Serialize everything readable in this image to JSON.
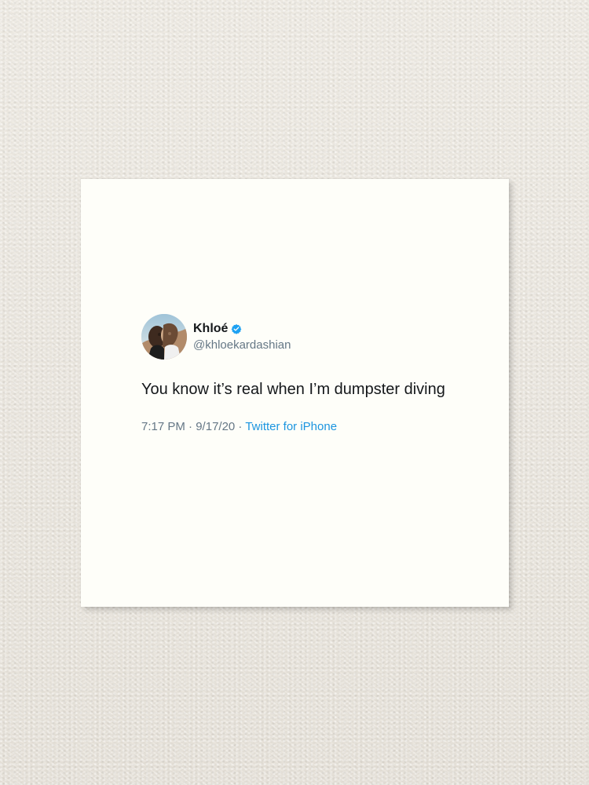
{
  "tweet": {
    "display_name": "Khloé",
    "handle": "@khloekardashian",
    "text": "You know it’s real when I’m dumpster diving",
    "time": "7:17 PM",
    "separator_1": " · ",
    "date": "9/17/20",
    "separator_2": " · ",
    "source": "Twitter for iPhone",
    "verified_icon": "verified-badge-icon"
  },
  "colors": {
    "wall": "#ece8e0",
    "paper": "#fefef9",
    "text": "#14171a",
    "muted": "#657786",
    "link": "#1b95e0",
    "verified": "#1da1f2"
  }
}
